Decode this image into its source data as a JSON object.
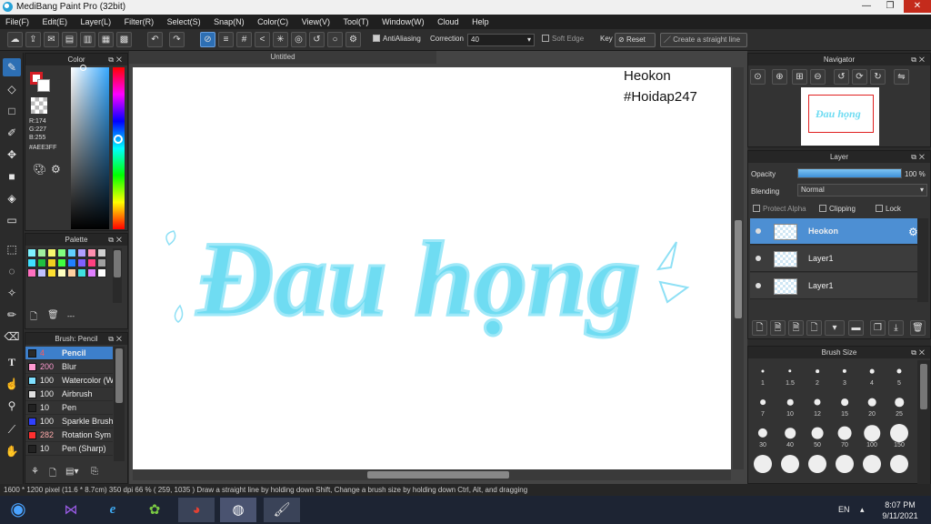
{
  "window": {
    "title": "MediBang Paint Pro (32bit)",
    "minimize": "—",
    "maximize": "❐",
    "close": "✕"
  },
  "menu": [
    "File(F)",
    "Edit(E)",
    "Layer(L)",
    "Filter(R)",
    "Select(S)",
    "Snap(N)",
    "Color(C)",
    "View(V)",
    "Tool(T)",
    "Window(W)",
    "Cloud",
    "Help"
  ],
  "toolbar": {
    "antialiasing_label": "AntiAliasing",
    "correction_label": "Correction",
    "correction_value": "40",
    "soft_edge_label": "Soft Edge",
    "key_label": "Key",
    "reset_label": "Reset",
    "straight_line_label": "Create a straight line"
  },
  "color_panel": {
    "title": "Color",
    "r": "R:174",
    "g": "G:227",
    "b": "B:255",
    "hex": "#AEE3FF",
    "current_color": "#AEE3FF",
    "foreground_color": "#d41c24"
  },
  "palette_panel": {
    "title": "Palette",
    "footer": "---",
    "colors": [
      "#7ff2ff",
      "#a0f0a0",
      "#f8f870",
      "#80ff80",
      "#60d0ff",
      "#b0a0ff",
      "#ff90b0",
      "#d0d0d0",
      "#40e0ff",
      "#20c040",
      "#f0d020",
      "#40ff40",
      "#2080ff",
      "#8060ff",
      "#ff4080",
      "#a0a0a0",
      "#ff70c0",
      "#c0c0ff",
      "#ffe030",
      "#ffffc0",
      "#ffd0a0",
      "#40e0e0",
      "#e080ff",
      "#ffffff"
    ]
  },
  "brush_panel": {
    "title": "Brush: Pencil",
    "items": [
      {
        "size": "4",
        "name": "Pencil",
        "color": "#2a2a2a"
      },
      {
        "size": "200",
        "name": "Blur",
        "color": "#ff9ad0"
      },
      {
        "size": "100",
        "name": "Watercolor (W",
        "color": "#7fe0ff"
      },
      {
        "size": "100",
        "name": "Airbrush",
        "color": "#e0e0e0"
      },
      {
        "size": "10",
        "name": "Pen",
        "color": "#222222"
      },
      {
        "size": "100",
        "name": "Sparkle Brush",
        "color": "#3040ff"
      },
      {
        "size": "282",
        "name": "Rotation Sym",
        "color": "#ff3030"
      },
      {
        "size": "10",
        "name": "Pen (Sharp)",
        "color": "#222222"
      }
    ]
  },
  "document": {
    "tab_title": "Untitled",
    "text_line1": "Heokon",
    "text_line2": "#Hoidap247",
    "lettering": "Đau họng"
  },
  "navigator": {
    "title": "Navigator"
  },
  "layer_panel": {
    "title": "Layer",
    "opacity_label": "Opacity",
    "opacity_value": "100 %",
    "opacity_fraction": 1.0,
    "blending_label": "Blending",
    "blending_value": "Normal",
    "protect_alpha_label": "Protect Alpha",
    "clipping_label": "Clipping",
    "lock_label": "Lock",
    "layers": [
      {
        "name": "Heokon",
        "selected": true
      },
      {
        "name": "Layer1",
        "selected": false
      },
      {
        "name": "Layer1",
        "selected": false
      }
    ]
  },
  "brush_size_panel": {
    "title": "Brush Size",
    "sizes": [
      "1",
      "1.5",
      "2",
      "3",
      "4",
      "5",
      "7",
      "10",
      "12",
      "15",
      "20",
      "25",
      "30",
      "40",
      "50",
      "70",
      "100",
      "150",
      "",
      "",
      "",
      "",
      "",
      ""
    ]
  },
  "status": {
    "text": "1600 * 1200 pixel   (11.6 * 8.7cm)   350 dpi   66 %   ( 259, 1035 )   Draw a straight line by holding down Shift, Change a brush size by holding down Ctrl, Alt, and dragging"
  },
  "taskbar": {
    "lang": "EN",
    "time": "8:07 PM",
    "date": "9/11/2021"
  }
}
